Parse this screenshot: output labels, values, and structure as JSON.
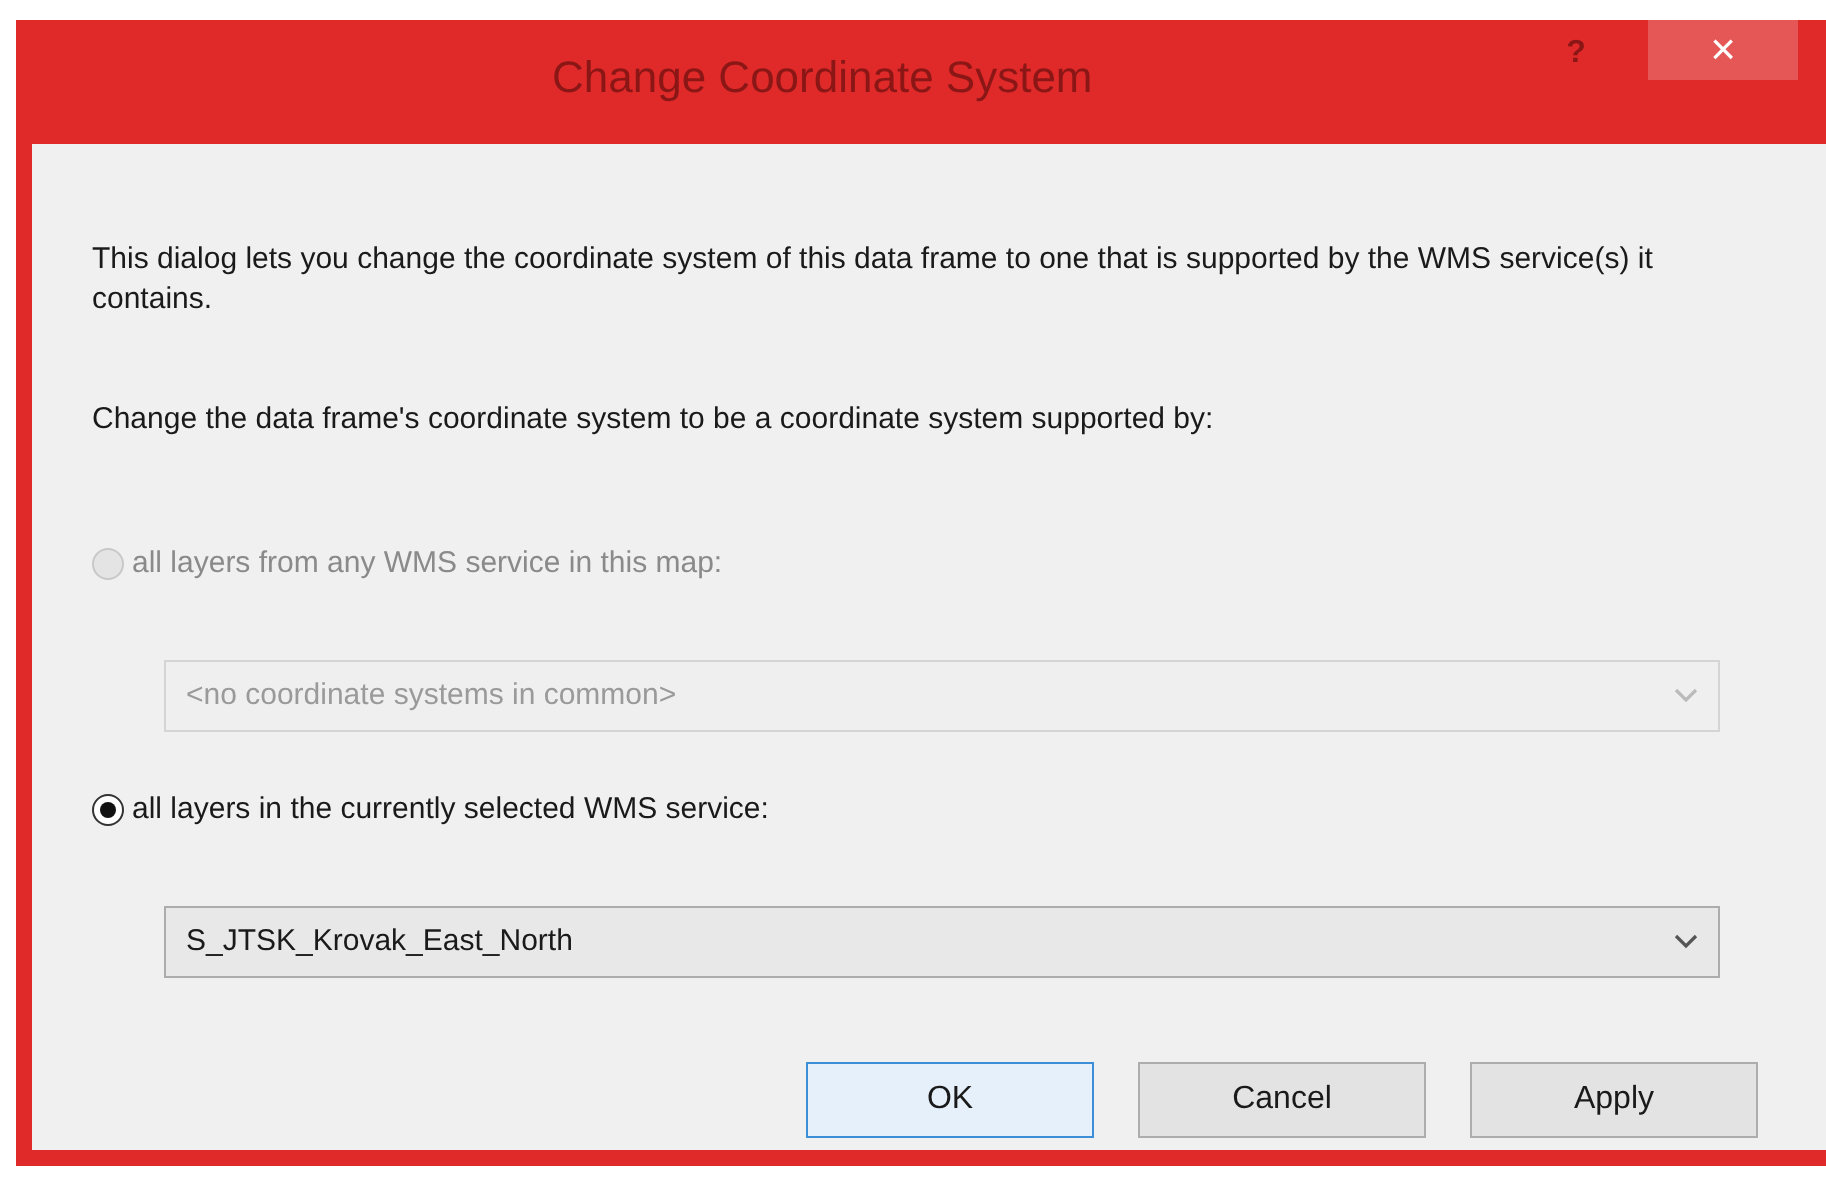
{
  "window": {
    "title": "Change Coordinate System",
    "help": "?",
    "close": "×"
  },
  "description": "This dialog lets you change the coordinate system of this data frame to one that is supported by the WMS service(s) it contains.",
  "prompt": "Change the data frame's coordinate system to be a coordinate system supported by:",
  "options": [
    {
      "label": "all layers from any WMS service in this map:",
      "selected": false,
      "disabled": true,
      "dropdown": {
        "value": "<no coordinate systems in common>",
        "disabled": true
      }
    },
    {
      "label": "all layers in the currently selected WMS service:",
      "selected": true,
      "disabled": false,
      "dropdown": {
        "value": "S_JTSK_Krovak_East_North",
        "disabled": false
      }
    }
  ],
  "buttons": [
    {
      "label": "OK",
      "default": true
    },
    {
      "label": "Cancel",
      "default": false
    },
    {
      "label": "Apply",
      "default": false
    }
  ]
}
